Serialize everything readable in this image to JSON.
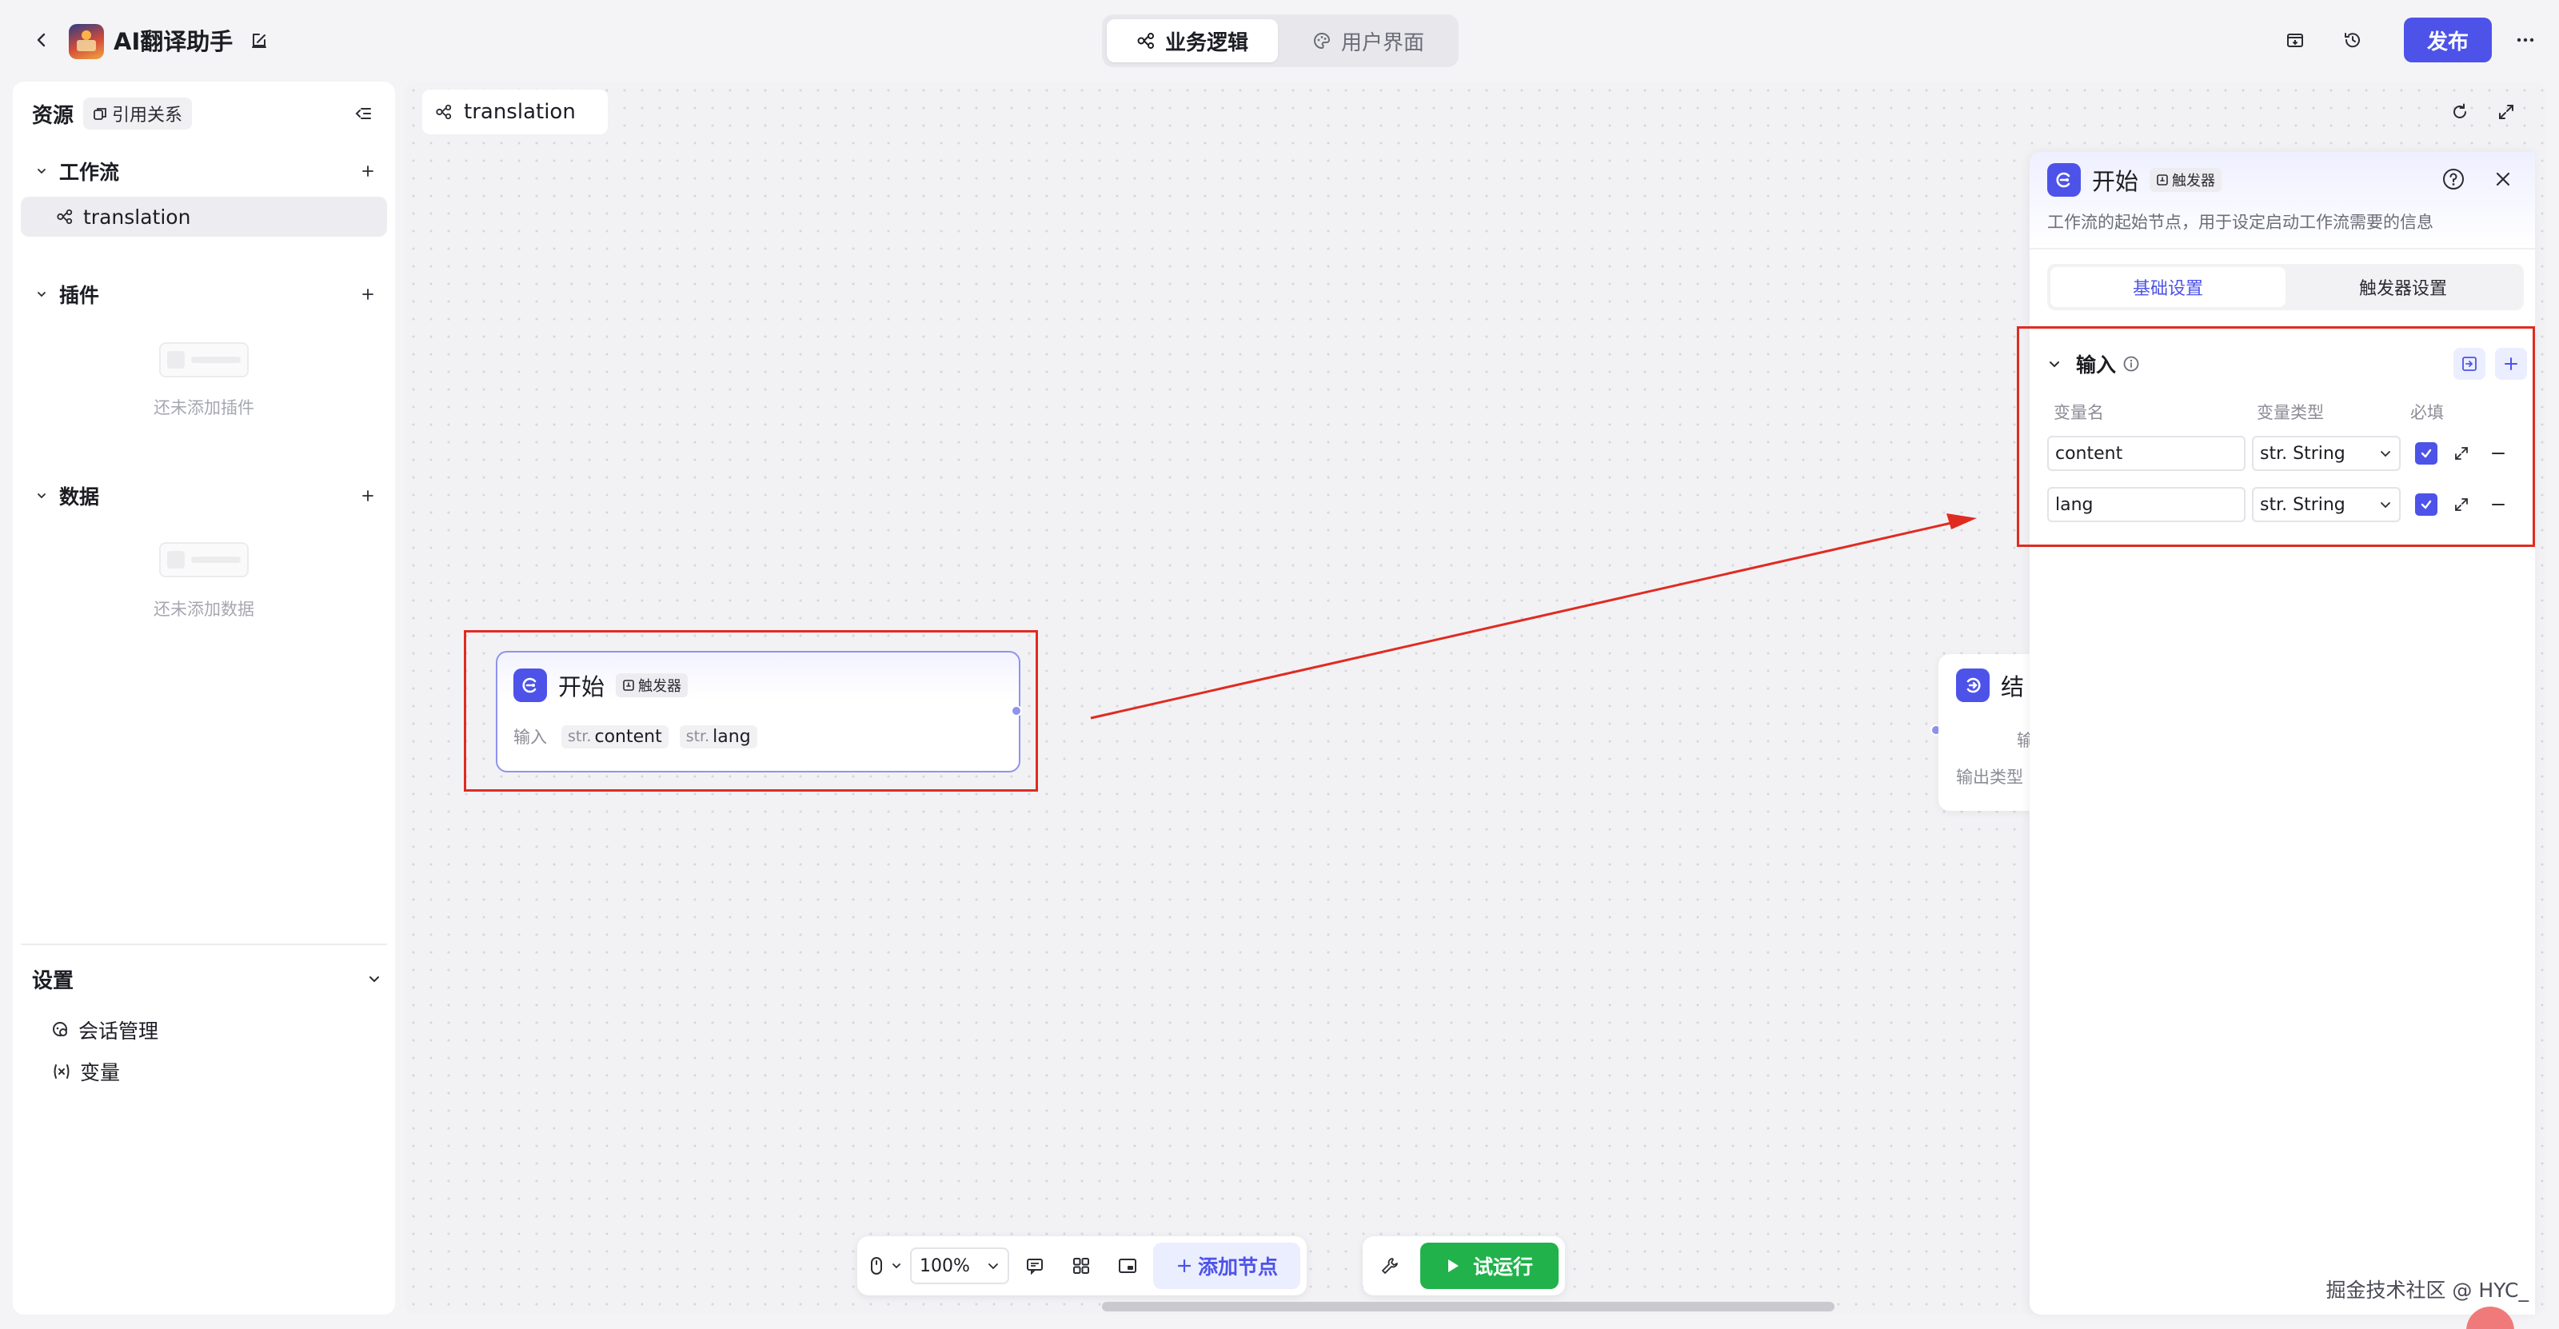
{
  "header": {
    "app_title": "AI翻译助手",
    "tabs": [
      {
        "label": "业务逻辑",
        "icon": "workflow-icon",
        "active": true
      },
      {
        "label": "用户界面",
        "icon": "palette-icon",
        "active": false
      }
    ],
    "publish_label": "发布"
  },
  "sidebar": {
    "title": "资源",
    "ref_label": "引用关系",
    "sections": {
      "workflow": {
        "label": "工作流",
        "items": [
          "translation"
        ]
      },
      "plugin": {
        "label": "插件",
        "empty_text": "还未添加插件"
      },
      "data": {
        "label": "数据",
        "empty_text": "还未添加数据"
      }
    },
    "settings": {
      "label": "设置",
      "items": [
        "会话管理",
        "变量"
      ]
    }
  },
  "canvas": {
    "tab_label": "translation",
    "start_node": {
      "title": "开始",
      "badge": "触发器",
      "input_label": "输入",
      "type_prefix": "str.",
      "vars": [
        "content",
        "lang"
      ]
    },
    "end_node": {
      "title": "结",
      "output_label": "输出",
      "output_type_label": "输出类型"
    },
    "toolbar": {
      "zoom": "100%",
      "add_node_label": "添加节点",
      "run_label": "试运行"
    }
  },
  "panel": {
    "title": "开始",
    "badge": "触发器",
    "description": "工作流的起始节点，用于设定启动工作流需要的信息",
    "tabs": [
      "基础设置",
      "触发器设置"
    ],
    "section_label": "输入",
    "columns": [
      "变量名",
      "变量类型",
      "必填"
    ],
    "rows": [
      {
        "name": "content",
        "type": "str. String",
        "required": true
      },
      {
        "name": "lang",
        "type": "str. String",
        "required": true
      }
    ]
  },
  "watermark": "掘金技术社区 @ HYC_",
  "colors": {
    "accent": "#4d53e8",
    "run": "#21b24b",
    "highlight": "#e02b21"
  }
}
